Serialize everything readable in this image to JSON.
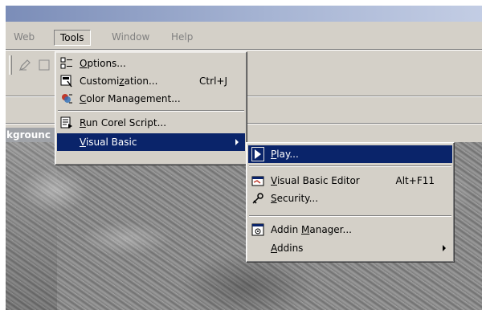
{
  "menubar": {
    "web": "Web",
    "tools": "Tools",
    "window": "Window",
    "help": "Help"
  },
  "document": {
    "tab_text": "kgrounc"
  },
  "tools_menu": {
    "items": [
      {
        "label": "Options...",
        "shortcut": "",
        "icon": "options-icon"
      },
      {
        "label": "Customization...",
        "shortcut": "Ctrl+J",
        "icon": "customization-icon"
      },
      {
        "label": "Color Management...",
        "shortcut": "",
        "icon": "color-management-icon"
      },
      {
        "label": "Run Corel Script...",
        "shortcut": "",
        "icon": "run-script-icon"
      },
      {
        "label": "Visual Basic",
        "shortcut": "",
        "icon": ""
      }
    ]
  },
  "vb_menu": {
    "items": [
      {
        "label": "Play...",
        "shortcut": "",
        "icon": "play-icon"
      },
      {
        "label": "Visual Basic Editor",
        "shortcut": "Alt+F11",
        "icon": "vb-editor-icon"
      },
      {
        "label": "Security...",
        "shortcut": "",
        "icon": "security-key-icon"
      },
      {
        "label": "Addin Manager...",
        "shortcut": "",
        "icon": "addin-manager-icon"
      },
      {
        "label": "Addins",
        "shortcut": "",
        "icon": ""
      }
    ]
  },
  "colors": {
    "menu_bg": "#d4d0c8",
    "highlight": "#0a246a",
    "highlight_text": "#ffffff"
  }
}
